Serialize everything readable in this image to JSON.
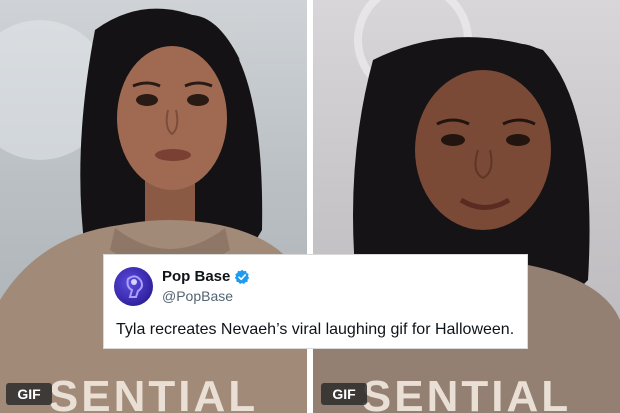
{
  "left_panel": {
    "badge": "GIF",
    "hoodie_text": "SENTIAL"
  },
  "right_panel": {
    "badge": "GIF",
    "hoodie_text": "SENTIAL"
  },
  "tweet": {
    "display_name": "Pop Base",
    "handle": "@PopBase",
    "text": "Tyla recreates Nevaeh’s viral laughing gif for Halloween.",
    "verified_icon": "verified-badge-icon",
    "accent_color": "#1d9bf0"
  }
}
